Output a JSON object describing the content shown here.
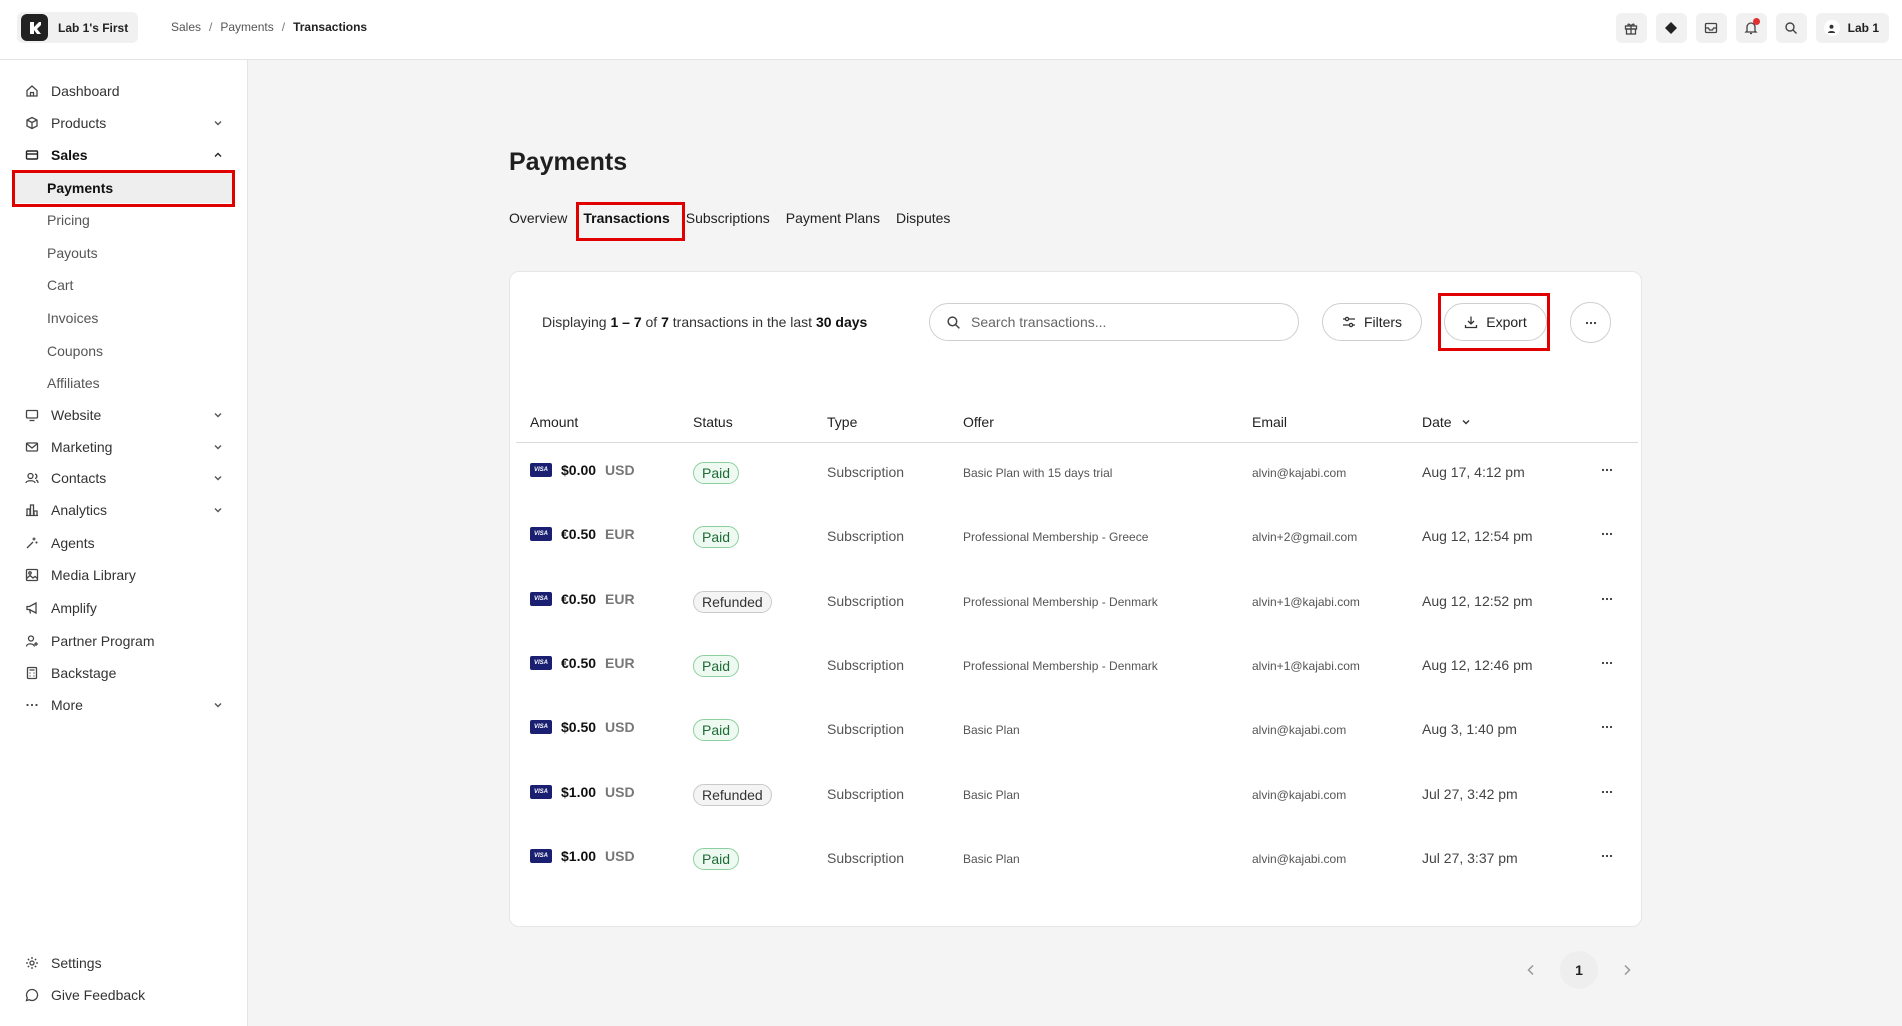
{
  "topbar": {
    "site_name": "Lab 1's First",
    "breadcrumb": [
      "Sales",
      "Payments",
      "Transactions"
    ],
    "user_name": "Lab 1"
  },
  "sidebar": {
    "items": [
      {
        "label": "Dashboard",
        "icon": "home-icon"
      },
      {
        "label": "Products",
        "icon": "box-icon"
      },
      {
        "label": "Sales",
        "icon": "credit-card-icon"
      },
      {
        "label": "Website",
        "icon": "monitor-icon"
      },
      {
        "label": "Marketing",
        "icon": "mail-icon"
      },
      {
        "label": "Contacts",
        "icon": "users-icon"
      },
      {
        "label": "Analytics",
        "icon": "bar-chart-icon"
      },
      {
        "label": "Agents",
        "icon": "sparkle-icon"
      },
      {
        "label": "Media Library",
        "icon": "image-icon"
      },
      {
        "label": "Amplify",
        "icon": "megaphone-icon"
      },
      {
        "label": "Partner Program",
        "icon": "partner-icon"
      },
      {
        "label": "Backstage",
        "icon": "calculator-icon"
      },
      {
        "label": "More",
        "icon": "more-dots-icon"
      }
    ],
    "sales_sub": [
      "Payments",
      "Pricing",
      "Payouts",
      "Cart",
      "Invoices",
      "Coupons",
      "Affiliates"
    ],
    "footer": [
      {
        "label": "Settings",
        "icon": "gear-icon"
      },
      {
        "label": "Give Feedback",
        "icon": "chat-icon"
      }
    ]
  },
  "main": {
    "title": "Payments",
    "tabs": [
      "Overview",
      "Transactions",
      "Subscriptions",
      "Payment Plans",
      "Disputes"
    ],
    "summary": {
      "prefix": "Displaying ",
      "range": "1 – 7",
      "of": " of ",
      "total": "7",
      "mid": " transactions in the last ",
      "period": "30 days"
    },
    "search_placeholder": "Search transactions...",
    "filters_label": "Filters",
    "export_label": "Export",
    "columns": [
      "Amount",
      "Status",
      "Type",
      "Offer",
      "Email",
      "Date"
    ],
    "rows": [
      {
        "amount": "$0.00",
        "currency": "USD",
        "status": "Paid",
        "type": "Subscription",
        "offer": "Basic Plan with 15 days trial",
        "email": "alvin@kajabi.com",
        "date": "Aug 17, 4:12 pm"
      },
      {
        "amount": "€0.50",
        "currency": "EUR",
        "status": "Paid",
        "type": "Subscription",
        "offer": "Professional Membership - Greece",
        "email": "alvin+2@gmail.com",
        "date": "Aug 12, 12:54 pm"
      },
      {
        "amount": "€0.50",
        "currency": "EUR",
        "status": "Refunded",
        "type": "Subscription",
        "offer": "Professional Membership - Denmark",
        "email": "alvin+1@kajabi.com",
        "date": "Aug 12, 12:52 pm"
      },
      {
        "amount": "€0.50",
        "currency": "EUR",
        "status": "Paid",
        "type": "Subscription",
        "offer": "Professional Membership - Denmark",
        "email": "alvin+1@kajabi.com",
        "date": "Aug 12, 12:46 pm"
      },
      {
        "amount": "$0.50",
        "currency": "USD",
        "status": "Paid",
        "type": "Subscription",
        "offer": "Basic Plan",
        "email": "alvin@kajabi.com",
        "date": "Aug 3, 1:40 pm"
      },
      {
        "amount": "$1.00",
        "currency": "USD",
        "status": "Refunded",
        "type": "Subscription",
        "offer": "Basic Plan",
        "email": "alvin@kajabi.com",
        "date": "Jul 27, 3:42 pm"
      },
      {
        "amount": "$1.00",
        "currency": "USD",
        "status": "Paid",
        "type": "Subscription",
        "offer": "Basic Plan",
        "email": "alvin@kajabi.com",
        "date": "Jul 27, 3:37 pm"
      }
    ],
    "card_brand": "VISA",
    "current_page": "1"
  },
  "colors": {
    "highlight": "#e00000",
    "paid_green": "#1d6b35"
  }
}
